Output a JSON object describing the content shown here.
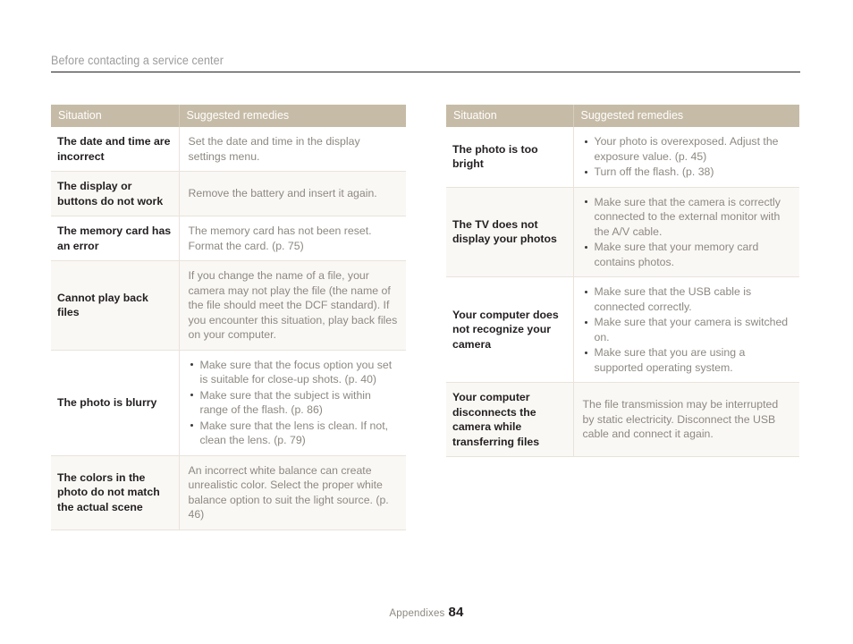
{
  "header": {
    "running_title": "Before contacting a service center"
  },
  "columns": {
    "situation": "Situation",
    "remedies": "Suggested remedies"
  },
  "left_table": {
    "rows": [
      {
        "situation": "The date and time are incorrect",
        "remedy_text": "Set the date and time in the display settings menu.",
        "remedy_bullets": []
      },
      {
        "situation": "The display or buttons do not work",
        "remedy_text": "Remove the battery and insert it again.",
        "remedy_bullets": []
      },
      {
        "situation": "The memory card has an error",
        "remedy_text": "The memory card has not been reset. Format the card. (p. 75)",
        "remedy_bullets": []
      },
      {
        "situation": "Cannot play back files",
        "remedy_text": "If you change the name of a file, your camera may not play the file (the name of the file should meet the DCF standard). If you encounter this situation, play back files on your computer.",
        "remedy_bullets": []
      },
      {
        "situation": "The photo is blurry",
        "remedy_text": "",
        "remedy_bullets": [
          "Make sure that the focus option you set is suitable for close-up shots. (p. 40)",
          "Make sure that the subject is within range of the flash. (p. 86)",
          "Make sure that the lens is clean. If not, clean the lens. (p. 79)"
        ]
      },
      {
        "situation": "The colors in the photo do not match the actual scene",
        "remedy_text": "An incorrect white balance can create unrealistic color. Select the proper white balance option to suit the light source. (p. 46)",
        "remedy_bullets": []
      }
    ]
  },
  "right_table": {
    "rows": [
      {
        "situation": "The photo is too bright",
        "remedy_text": "",
        "remedy_bullets": [
          "Your photo is overexposed. Adjust the exposure value. (p. 45)",
          "Turn off the flash. (p. 38)"
        ]
      },
      {
        "situation": "The TV does not display your photos",
        "remedy_text": "",
        "remedy_bullets": [
          "Make sure that the camera is correctly connected to the external monitor with the A/V cable.",
          "Make sure that your memory card contains photos."
        ]
      },
      {
        "situation": "Your computer does not recognize your camera",
        "remedy_text": "",
        "remedy_bullets": [
          "Make sure that the USB cable is connected correctly.",
          "Make sure that your camera is switched on.",
          "Make sure that you are using a supported operating system."
        ]
      },
      {
        "situation": "Your computer disconnects the camera while transferring files",
        "remedy_text": "The file transmission may be interrupted by static electricity. Disconnect the USB cable and connect it again.",
        "remedy_bullets": []
      }
    ]
  },
  "footer": {
    "section": "Appendixes",
    "page_number": "84"
  },
  "colors": {
    "header_band": "#c6bba6",
    "header_band_text": "#ffffff",
    "body_text": "#8d8882",
    "situation_text": "#231f20",
    "row_shade": "#faf8f5",
    "row_plain": "#ffffff",
    "cell_border": "#e9e3da",
    "rule": "#231f20",
    "running_title_text": "#9c9c9c"
  }
}
